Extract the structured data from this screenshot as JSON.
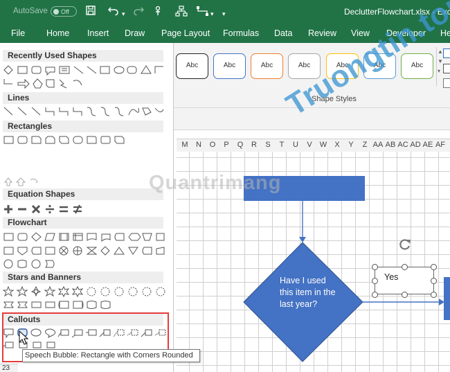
{
  "titlebar": {
    "autosave_label": "AutoSave",
    "autosave_state": "Off",
    "filename": "DeclutterFlowchart.xlsx  -  Exc"
  },
  "tabs": [
    "File",
    "Home",
    "Insert",
    "Draw",
    "Page Layout",
    "Formulas",
    "Data",
    "Review",
    "View",
    "Developer",
    "He"
  ],
  "ribbon": {
    "style_buttons": [
      {
        "label": "Abc",
        "border": "#222222"
      },
      {
        "label": "Abc",
        "border": "#4472c4"
      },
      {
        "label": "Abc",
        "border": "#ed7d31"
      },
      {
        "label": "Abc",
        "border": "#a5a5a5"
      },
      {
        "label": "Abc",
        "border": "#ffc000"
      },
      {
        "label": "Abc",
        "border": "#5b9bd5"
      },
      {
        "label": "Abc",
        "border": "#70ad47"
      }
    ],
    "group_label": "Shape Styles"
  },
  "columns": [
    "M",
    "N",
    "O",
    "P",
    "Q",
    "R",
    "S",
    "T",
    "U",
    "V",
    "W",
    "X",
    "Y",
    "Z",
    "AA",
    "AB",
    "AC",
    "AD",
    "AE",
    "AF"
  ],
  "shapes_panel": {
    "categories": {
      "recent": "Recently Used Shapes",
      "lines": "Lines",
      "rectangles": "Rectangles",
      "equation": "Equation Shapes",
      "flowchart": "Flowchart",
      "stars": "Stars and Banners",
      "callouts": "Callouts"
    },
    "tooltip": "Speech Bubble: Rectangle with Corners Rounded",
    "row_number": "23"
  },
  "flowchart": {
    "decision_text": "Have I used this item in the last year?",
    "yes_label": "Yes"
  },
  "watermarks": {
    "quantrimang": "Quantrimang",
    "truongtin": "Truongtin.top"
  },
  "colors": {
    "excel_green": "#217346",
    "shape_blue": "#4472c4",
    "highlight_red": "#e53b3b"
  }
}
